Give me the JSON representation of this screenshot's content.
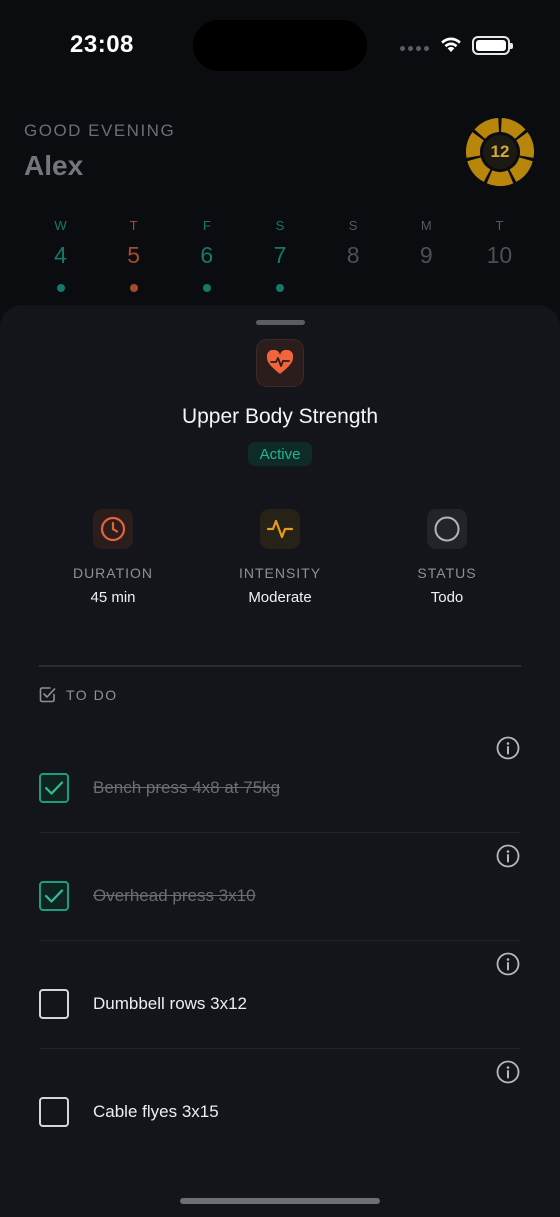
{
  "status_bar": {
    "time": "23:08"
  },
  "header": {
    "greeting": "GOOD EVENING",
    "name": "Alex",
    "streak_count": "12",
    "streak_color": "#b8860b"
  },
  "week": [
    {
      "letter": "W",
      "num": "4",
      "color": "teal",
      "dot": "teal"
    },
    {
      "letter": "T",
      "num": "5",
      "color": "orange",
      "dot": "orange"
    },
    {
      "letter": "F",
      "num": "6",
      "color": "teal",
      "dot": "teal"
    },
    {
      "letter": "S",
      "num": "7",
      "color": "teal",
      "dot": "teal"
    },
    {
      "letter": "S",
      "num": "8",
      "color": "none",
      "dot": "none"
    },
    {
      "letter": "M",
      "num": "9",
      "color": "none",
      "dot": "none"
    },
    {
      "letter": "T",
      "num": "10",
      "color": "none",
      "dot": "none"
    }
  ],
  "sheet": {
    "icon": "heart-pulse-icon",
    "title": "Upper Body Strength",
    "badge": "Active",
    "stats": [
      {
        "icon": "clock-icon",
        "label": "DURATION",
        "value": "45 min",
        "color": "#e8613a"
      },
      {
        "icon": "activity-icon",
        "label": "INTENSITY",
        "value": "Moderate",
        "color": "#e89a1a"
      },
      {
        "icon": "circle-icon",
        "label": "STATUS",
        "value": "Todo",
        "color": "#9a9ca3"
      }
    ],
    "todo_label": "TO DO",
    "tasks": [
      {
        "label": "Bench press 4x8 at 75kg",
        "done": true
      },
      {
        "label": "Overhead press 3x10",
        "done": true
      },
      {
        "label": "Dumbbell rows 3x12",
        "done": false
      },
      {
        "label": "Cable flyes 3x15",
        "done": false
      }
    ]
  },
  "colors": {
    "accent_teal": "#1fb596",
    "accent_orange": "#e8613a",
    "sheet_bg": "#13151b"
  }
}
